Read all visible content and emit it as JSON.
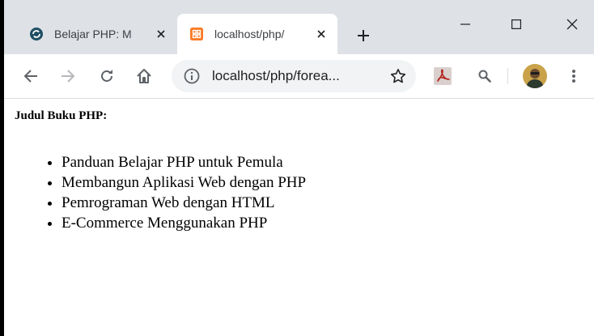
{
  "browser": {
    "tabs": [
      {
        "title": "Belajar PHP: M",
        "favicon": "circle-refresh-icon",
        "active": false
      },
      {
        "title": "localhost/php/",
        "favicon": "xampp-icon",
        "active": true
      }
    ],
    "address_bar": {
      "url": "localhost/php/forea..."
    },
    "colors": {
      "tabstrip": "#dee1e6",
      "omnibox": "#f1f3f4",
      "icon": "#5f6368",
      "xampp": "#fb7a24",
      "pdf": "#b3261e"
    }
  },
  "page": {
    "heading": "Judul Buku PHP:",
    "books": [
      "Panduan Belajar PHP untuk Pemula",
      "Membangun Aplikasi Web dengan PHP",
      "Pemrograman Web dengan HTML",
      "E-Commerce Menggunakan PHP"
    ]
  }
}
